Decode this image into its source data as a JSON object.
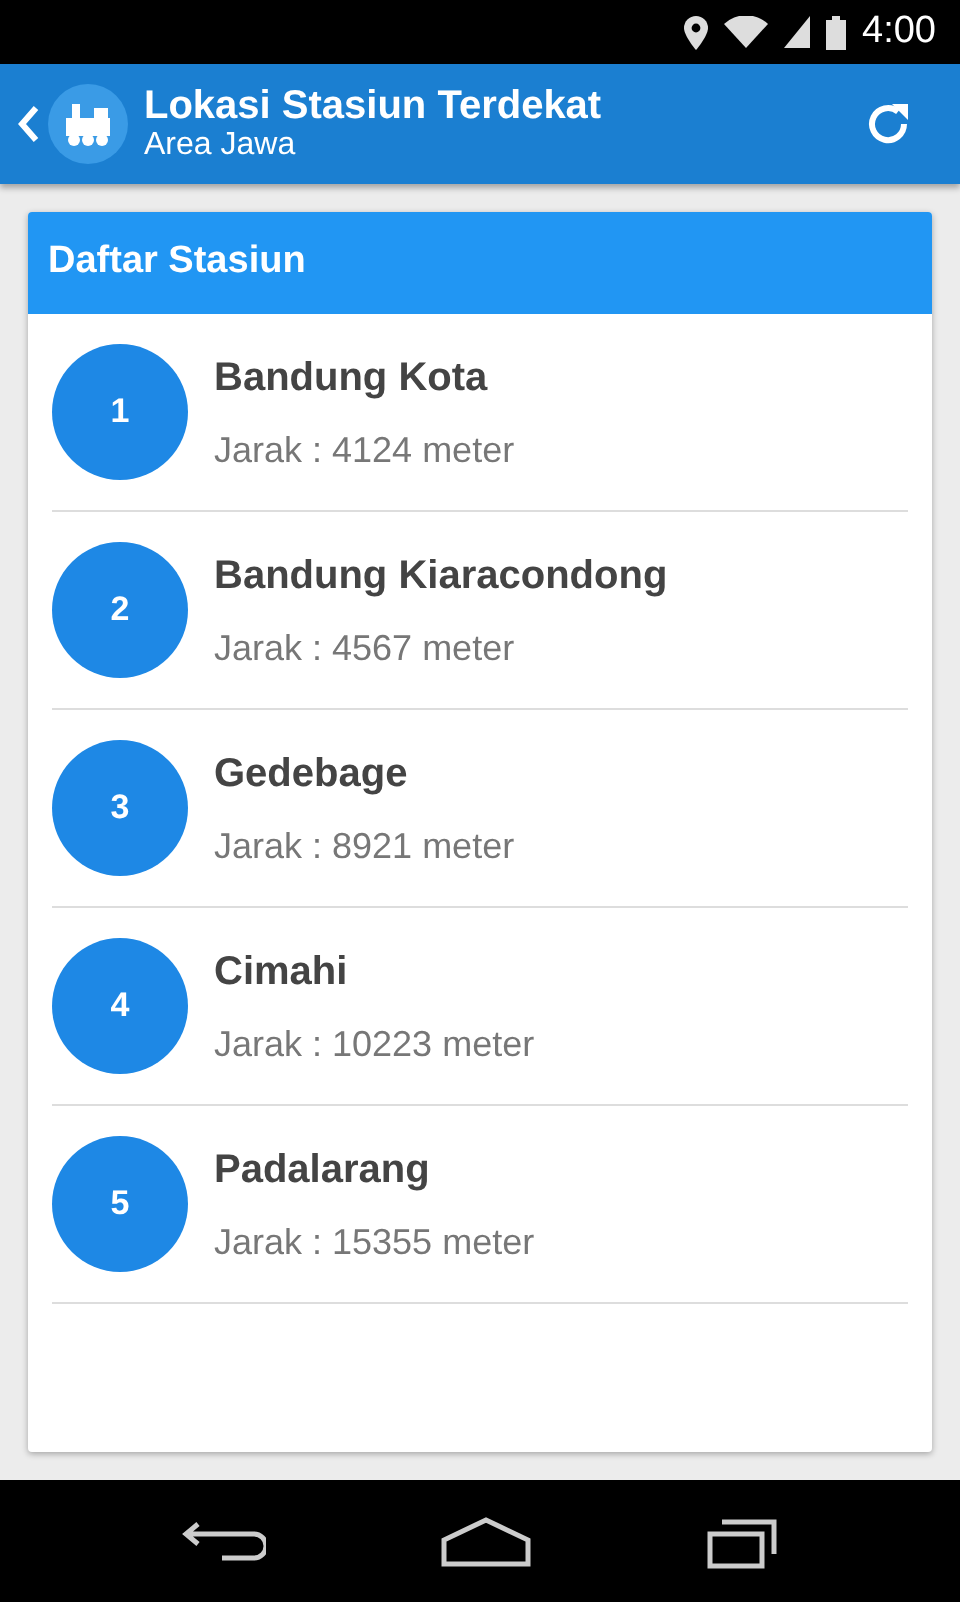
{
  "status_bar": {
    "time": "4:00"
  },
  "app_bar": {
    "title": "Lokasi Stasiun Terdekat",
    "subtitle": "Area Jawa"
  },
  "card": {
    "title": "Daftar Stasiun",
    "stations": [
      {
        "number": "1",
        "name": "Bandung Kota",
        "distance": "Jarak : 4124 meter"
      },
      {
        "number": "2",
        "name": "Bandung Kiaracondong",
        "distance": "Jarak : 4567 meter"
      },
      {
        "number": "3",
        "name": "Gedebage",
        "distance": "Jarak : 8921 meter"
      },
      {
        "number": "4",
        "name": "Cimahi",
        "distance": "Jarak : 10223 meter"
      },
      {
        "number": "5",
        "name": "Padalarang",
        "distance": "Jarak : 15355 meter"
      }
    ]
  }
}
